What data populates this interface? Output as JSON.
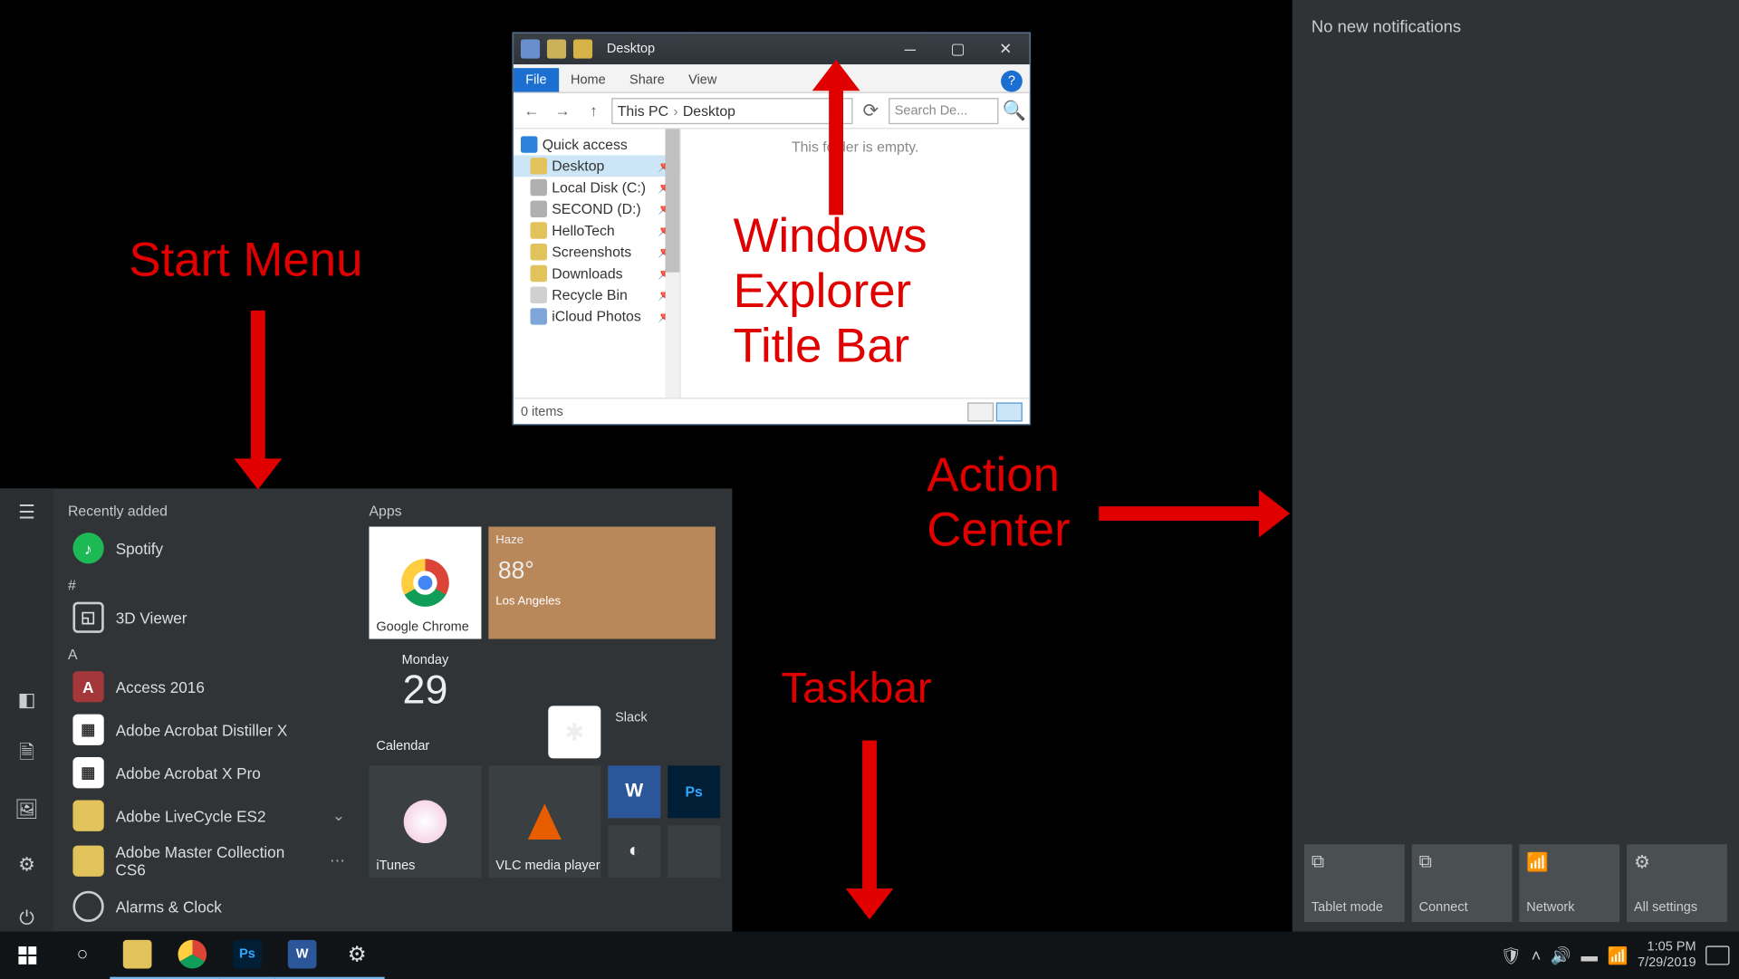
{
  "explorer": {
    "title": "Desktop",
    "tabs": {
      "file": "File",
      "home": "Home",
      "share": "Share",
      "view": "View"
    },
    "breadcrumb": {
      "root": "This PC",
      "current": "Desktop"
    },
    "search_placeholder": "Search De...",
    "nav": {
      "quick_access": "Quick access",
      "items": [
        {
          "label": "Desktop"
        },
        {
          "label": "Local Disk (C:)"
        },
        {
          "label": "SECOND (D:)"
        },
        {
          "label": "HelloTech"
        },
        {
          "label": "Screenshots"
        },
        {
          "label": "Downloads"
        },
        {
          "label": "Recycle Bin"
        },
        {
          "label": "iCloud Photos"
        }
      ]
    },
    "content_empty": "This folder is empty.",
    "status": "0 items"
  },
  "start_menu": {
    "recently_added": "Recently added",
    "apps_header": "Apps",
    "letter_hash": "#",
    "letter_a": "A",
    "apps": {
      "spotify": "Spotify",
      "viewer3d": "3D Viewer",
      "access": "Access 2016",
      "distiller": "Adobe Acrobat Distiller X",
      "acrobat": "Adobe Acrobat X Pro",
      "livecycle": "Adobe LiveCycle ES2",
      "mastercoll": "Adobe Master Collection CS6",
      "alarms": "Alarms & Clock"
    },
    "tiles": {
      "chrome": "Google Chrome",
      "weather_tag": "Haze",
      "weather_temp": "88°",
      "weather_loc": "Los Angeles",
      "cal_day": "Monday",
      "cal_num": "29",
      "calendar": "Calendar",
      "slack": "Slack",
      "itunes": "iTunes",
      "vlc": "VLC media player"
    }
  },
  "action_center": {
    "no_notif": "No new notifications",
    "tiles": {
      "tablet": "Tablet mode",
      "connect": "Connect",
      "network": "Network",
      "settings": "All settings"
    }
  },
  "taskbar": {
    "time": "1:05 PM",
    "date": "7/29/2019"
  },
  "annotations": {
    "start": "Start Menu",
    "explorer": "Windows\nExplorer\nTitle Bar",
    "action": "Action\nCenter",
    "taskbar": "Taskbar"
  }
}
